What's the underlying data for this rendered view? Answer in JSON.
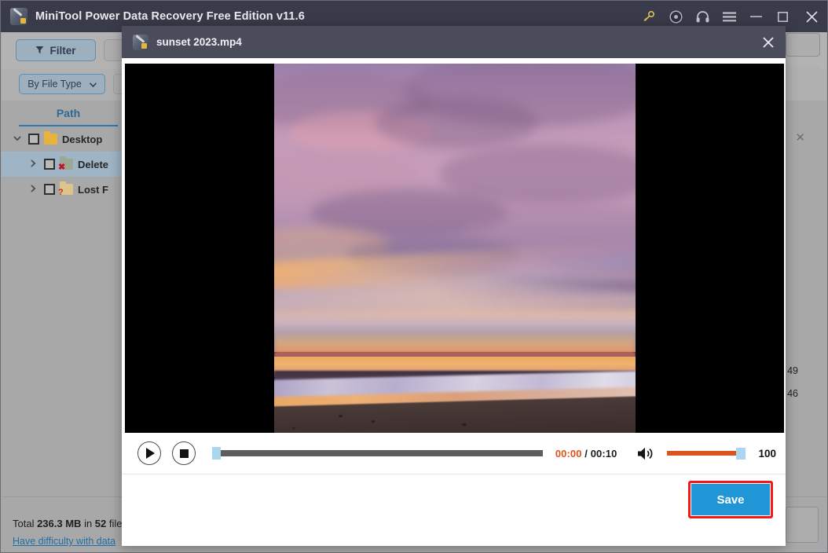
{
  "app": {
    "title": "MiniTool Power Data Recovery Free Edition v11.6",
    "icon": "minitool-logo-icon",
    "titlebar_buttons": [
      {
        "name": "key-icon",
        "label": ""
      },
      {
        "name": "record-icon",
        "label": ""
      },
      {
        "name": "headset-icon",
        "label": ""
      },
      {
        "name": "menu-icon",
        "label": ""
      },
      {
        "name": "minimize-icon",
        "label": ""
      },
      {
        "name": "maximize-icon",
        "label": ""
      },
      {
        "name": "close-icon",
        "label": ""
      }
    ]
  },
  "toolbar": {
    "filter_label": "Filter",
    "filter_icon": "funnel-icon",
    "file_type_label": "By File Type",
    "file_type_caret": "chevron-down-icon"
  },
  "left_panel": {
    "header": "Path",
    "tree": [
      {
        "label": "Desktop",
        "indent": 0,
        "expanded": true,
        "checked": false,
        "icon": "folder-yellow-icon",
        "selected": false,
        "badge": ""
      },
      {
        "label": "Delete",
        "indent": 1,
        "expanded": false,
        "checked": false,
        "icon": "folder-deleted-icon",
        "selected": true,
        "badge": "x"
      },
      {
        "label": "Lost F",
        "indent": 1,
        "expanded": false,
        "checked": false,
        "icon": "folder-lost-icon",
        "selected": false,
        "badge": "?"
      }
    ]
  },
  "right_edge": {
    "close_icon": "close-icon",
    "cut_values": [
      "49",
      "46"
    ]
  },
  "status_bar": {
    "total_prefix": "Total ",
    "total_size": "236.3 MB",
    "total_middle": " in ",
    "total_count": "52",
    "total_suffix": " file",
    "help_link": "Have difficulty with data "
  },
  "preview_modal": {
    "icon": "minitool-logo-icon",
    "title": "sunset 2023.mp4",
    "close_icon": "close-icon",
    "player": {
      "play_icon": "play-icon",
      "stop_icon": "stop-icon",
      "progress_percent": 0,
      "time_current": "00:00",
      "time_separator": " / ",
      "time_total": "00:10",
      "volume_icon": "speaker-icon",
      "volume_percent": 100,
      "volume_value": "100"
    },
    "save_label": "Save",
    "save_highlight_color": "#f01a1a",
    "save_color": "#2196d6"
  },
  "colors": {
    "titlebar": "#393b4a",
    "modal_header": "#4a4c5c",
    "accent_blue": "#2196d6",
    "accent_orange": "#d9541e",
    "window_bg": "#a8a8a8"
  }
}
